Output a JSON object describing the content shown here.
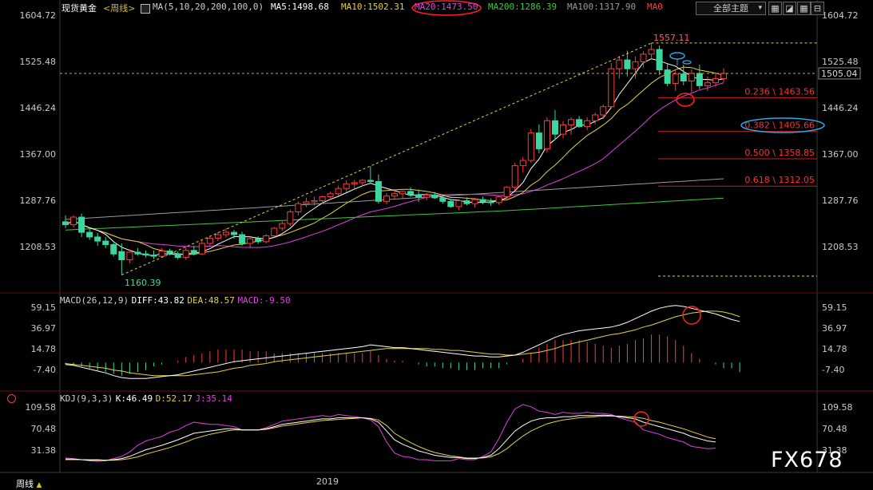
{
  "header": {
    "symbol": "现货黄金",
    "period": "周线",
    "ma_def": "MA(5,10,20,200,100,0)",
    "ma5": "MA5:1498.68",
    "ma10": "MA10:1502.31",
    "ma20": "MA20:1473.50",
    "ma200": "MA200:1286.39",
    "ma100": "MA100:1317.90",
    "ma0": "MA0",
    "theme_button": "全部主题",
    "macd": "MACD(26,12,9)",
    "diff": "DIFF:43.82",
    "dea": "DEA:48.57",
    "macd_val": "MACD:-9.50",
    "kdj": "KDJ(9,3,3)",
    "k": "K:46.49",
    "d": "D:52.17",
    "j": "J:35.14"
  },
  "footer": {
    "period_tab": "周线",
    "year": "2019"
  },
  "watermark": "FX678",
  "colors": {
    "up": "#ff3c3c",
    "down": "#3cd6a0",
    "ma5": "#ffffff",
    "ma10": "#e6d23c",
    "ma20": "#e040e0",
    "ma100": "#9a9a9a",
    "ma200": "#3cc83c",
    "dash": "#e6d23c",
    "circle_red": "#ff2020",
    "circle_blue": "#2aa8e8"
  },
  "chart_data": [
    {
      "type": "candlestick",
      "title": "现货黄金 周线",
      "ylim": [
        1160,
        1610
      ],
      "yticks": [
        "1604.72",
        "1525.48",
        "1446.24",
        "1367.00",
        "1287.76",
        "1208.53"
      ],
      "current_price": "1505.04",
      "high_label": "1557.11",
      "low_label": "1160.39",
      "fibonacci": [
        {
          "label": "0.236 \\ 1463.56",
          "value": 1463.56
        },
        {
          "label": "0.382 \\ 1405.66",
          "value": 1405.66
        },
        {
          "label": "0.500 \\ 1358.85",
          "value": 1358.85
        },
        {
          "label": "0.618 \\ 1312.05",
          "value": 1312.05
        }
      ],
      "candles": [
        [
          1251,
          1262,
          1240,
          1246
        ],
        [
          1246,
          1262,
          1241,
          1259
        ],
        [
          1259,
          1265,
          1225,
          1233
        ],
        [
          1233,
          1238,
          1220,
          1225
        ],
        [
          1225,
          1232,
          1210,
          1218
        ],
        [
          1218,
          1225,
          1206,
          1212
        ],
        [
          1212,
          1215,
          1192,
          1196
        ],
        [
          1200,
          1214,
          1160,
          1186
        ],
        [
          1186,
          1204,
          1180,
          1199
        ],
        [
          1199,
          1206,
          1193,
          1196
        ],
        [
          1196,
          1202,
          1190,
          1194
        ],
        [
          1194,
          1202,
          1187,
          1192
        ],
        [
          1192,
          1206,
          1190,
          1201
        ],
        [
          1201,
          1205,
          1193,
          1196
        ],
        [
          1196,
          1200,
          1187,
          1190
        ],
        [
          1190,
          1207,
          1186,
          1202
        ],
        [
          1202,
          1210,
          1193,
          1196
        ],
        [
          1196,
          1221,
          1194,
          1214
        ],
        [
          1214,
          1227,
          1210,
          1223
        ],
        [
          1223,
          1233,
          1218,
          1229
        ],
        [
          1229,
          1240,
          1224,
          1233
        ],
        [
          1233,
          1237,
          1222,
          1229
        ],
        [
          1229,
          1234,
          1210,
          1214
        ],
        [
          1214,
          1224,
          1206,
          1222
        ],
        [
          1222,
          1226,
          1213,
          1217
        ],
        [
          1217,
          1230,
          1214,
          1227
        ],
        [
          1227,
          1242,
          1224,
          1240
        ],
        [
          1240,
          1252,
          1235,
          1248
        ],
        [
          1248,
          1272,
          1244,
          1268
        ],
        [
          1268,
          1286,
          1262,
          1282
        ],
        [
          1282,
          1292,
          1276,
          1285
        ],
        [
          1285,
          1294,
          1279,
          1287
        ],
        [
          1287,
          1296,
          1282,
          1294
        ],
        [
          1294,
          1303,
          1289,
          1299
        ],
        [
          1299,
          1313,
          1295,
          1308
        ],
        [
          1308,
          1322,
          1302,
          1316
        ],
        [
          1316,
          1323,
          1308,
          1318
        ],
        [
          1318,
          1324,
          1312,
          1322
        ],
        [
          1322,
          1346,
          1318,
          1320
        ],
        [
          1320,
          1332,
          1282,
          1286
        ],
        [
          1286,
          1300,
          1281,
          1295
        ],
        [
          1295,
          1306,
          1289,
          1299
        ],
        [
          1299,
          1305,
          1291,
          1303
        ],
        [
          1303,
          1310,
          1294,
          1297
        ],
        [
          1297,
          1306,
          1285,
          1293
        ],
        [
          1293,
          1300,
          1288,
          1297
        ],
        [
          1297,
          1302,
          1290,
          1292
        ],
        [
          1292,
          1296,
          1282,
          1286
        ],
        [
          1286,
          1290,
          1275,
          1277
        ],
        [
          1277,
          1290,
          1271,
          1287
        ],
        [
          1287,
          1293,
          1279,
          1282
        ],
        [
          1282,
          1292,
          1276,
          1289
        ],
        [
          1289,
          1294,
          1281,
          1285
        ],
        [
          1285,
          1291,
          1278,
          1284
        ],
        [
          1284,
          1296,
          1280,
          1294
        ],
        [
          1294,
          1312,
          1290,
          1310
        ],
        [
          1310,
          1352,
          1305,
          1347
        ],
        [
          1347,
          1362,
          1335,
          1356
        ],
        [
          1356,
          1410,
          1352,
          1403
        ],
        [
          1403,
          1418,
          1368,
          1376
        ],
        [
          1376,
          1430,
          1370,
          1424
        ],
        [
          1424,
          1442,
          1391,
          1401
        ],
        [
          1401,
          1423,
          1394,
          1417
        ],
        [
          1417,
          1430,
          1400,
          1426
        ],
        [
          1426,
          1432,
          1412,
          1414
        ],
        [
          1414,
          1430,
          1408,
          1424
        ],
        [
          1424,
          1438,
          1418,
          1434
        ],
        [
          1434,
          1452,
          1427,
          1448
        ],
        [
          1448,
          1523,
          1445,
          1513
        ],
        [
          1513,
          1535,
          1496,
          1528
        ],
        [
          1528,
          1544,
          1500,
          1513
        ],
        [
          1513,
          1534,
          1496,
          1525
        ],
        [
          1525,
          1543,
          1515,
          1538
        ],
        [
          1538,
          1557,
          1530,
          1546
        ],
        [
          1546,
          1553,
          1502,
          1511
        ],
        [
          1511,
          1521,
          1483,
          1488
        ],
        [
          1488,
          1512,
          1475,
          1504
        ],
        [
          1504,
          1520,
          1485,
          1492
        ],
        [
          1492,
          1512,
          1473,
          1505
        ],
        [
          1505,
          1520,
          1478,
          1484
        ],
        [
          1484,
          1500,
          1475,
          1489
        ],
        [
          1489,
          1506,
          1482,
          1496
        ],
        [
          1496,
          1514,
          1490,
          1505
        ]
      ]
    },
    {
      "type": "macd",
      "title": "MACD(26,12,9)",
      "yticks": [
        "59.15",
        "36.97",
        "14.78",
        "-7.40"
      ],
      "ylim": [
        -15,
        67
      ],
      "series": [
        {
          "name": "DIFF",
          "values": [
            -2,
            -3,
            -5,
            -7,
            -9,
            -11,
            -14,
            -16,
            -17,
            -17,
            -17,
            -16,
            -15,
            -14,
            -13,
            -11,
            -9,
            -7,
            -5,
            -3,
            -1,
            1,
            2,
            3,
            4,
            5,
            6,
            7,
            8,
            9,
            10,
            11,
            12,
            13,
            14,
            15,
            16,
            17,
            19,
            18,
            17,
            16,
            16,
            15,
            14,
            13,
            12,
            11,
            10,
            9,
            8,
            7,
            7,
            6,
            6,
            7,
            8,
            11,
            15,
            19,
            23,
            27,
            30,
            32,
            34,
            35,
            36,
            37,
            38,
            40,
            43,
            47,
            51,
            55,
            58,
            60,
            61,
            60,
            58,
            56,
            54,
            52,
            49,
            46,
            44
          ]
        },
        {
          "name": "DEA",
          "values": [
            -1,
            -2,
            -3,
            -4,
            -5,
            -6,
            -8,
            -9,
            -11,
            -12,
            -13,
            -14,
            -14,
            -14,
            -14,
            -14,
            -13,
            -12,
            -11,
            -10,
            -8,
            -6,
            -5,
            -3,
            -2,
            -1,
            1,
            2,
            3,
            4,
            5,
            6,
            7,
            8,
            9,
            10,
            11,
            12,
            13,
            14,
            15,
            15,
            15,
            15,
            15,
            15,
            14,
            14,
            13,
            13,
            12,
            11,
            10,
            9,
            9,
            8,
            8,
            9,
            10,
            11,
            13,
            15,
            18,
            20,
            22,
            24,
            26,
            28,
            30,
            31,
            33,
            35,
            38,
            40,
            43,
            46,
            49,
            51,
            53,
            54,
            55,
            55,
            54,
            52,
            49
          ]
        },
        {
          "name": "MACD",
          "values": [
            -2,
            -2,
            -4,
            -6,
            -8,
            -10,
            -12,
            -14,
            -12,
            -10,
            -8,
            -4,
            -2,
            0,
            2,
            6,
            8,
            10,
            12,
            14,
            14,
            14,
            14,
            12,
            12,
            12,
            10,
            10,
            10,
            10,
            10,
            10,
            10,
            10,
            10,
            10,
            10,
            10,
            12,
            8,
            4,
            2,
            2,
            0,
            -2,
            -4,
            -4,
            -6,
            -6,
            -8,
            -8,
            -8,
            -6,
            -6,
            -6,
            -2,
            0,
            4,
            10,
            16,
            20,
            24,
            24,
            24,
            24,
            22,
            20,
            18,
            16,
            18,
            20,
            24,
            26,
            30,
            30,
            28,
            24,
            18,
            10,
            4,
            0,
            -2,
            -6,
            -6,
            -10
          ]
        }
      ]
    },
    {
      "type": "kdj",
      "title": "KDJ(9,3,3)",
      "yticks": [
        "109.58",
        "70.48",
        "31.38"
      ],
      "ylim": [
        5,
        118
      ],
      "series": [
        {
          "name": "K",
          "values": [
            15,
            15,
            14,
            13,
            13,
            13,
            14,
            16,
            20,
            26,
            32,
            36,
            40,
            45,
            50,
            56,
            62,
            64,
            66,
            68,
            70,
            70,
            68,
            68,
            68,
            70,
            74,
            78,
            80,
            82,
            84,
            86,
            88,
            88,
            90,
            90,
            90,
            90,
            88,
            82,
            66,
            50,
            42,
            36,
            30,
            26,
            22,
            20,
            18,
            18,
            16,
            16,
            18,
            22,
            34,
            50,
            66,
            76,
            84,
            88,
            90,
            90,
            92,
            92,
            94,
            94,
            94,
            95,
            94,
            92,
            90,
            88,
            82,
            78,
            74,
            70,
            66,
            62,
            56,
            52,
            48,
            46
          ]
        },
        {
          "name": "D",
          "values": [
            14,
            14,
            14,
            14,
            14,
            13,
            13,
            14,
            16,
            19,
            24,
            28,
            32,
            36,
            41,
            46,
            52,
            56,
            60,
            63,
            66,
            68,
            68,
            68,
            68,
            69,
            72,
            75,
            77,
            79,
            81,
            83,
            85,
            86,
            87,
            88,
            89,
            90,
            89,
            86,
            76,
            62,
            53,
            45,
            38,
            32,
            27,
            24,
            21,
            19,
            17,
            17,
            17,
            19,
            25,
            34,
            46,
            57,
            66,
            73,
            79,
            83,
            86,
            88,
            90,
            91,
            92,
            93,
            93,
            93,
            92,
            91,
            89,
            85,
            82,
            78,
            74,
            70,
            65,
            60,
            55,
            52
          ]
        },
        {
          "name": "J",
          "values": [
            17,
            16,
            14,
            12,
            11,
            12,
            16,
            20,
            28,
            40,
            48,
            52,
            56,
            64,
            68,
            76,
            82,
            80,
            78,
            78,
            76,
            74,
            68,
            68,
            68,
            72,
            78,
            84,
            86,
            88,
            90,
            92,
            94,
            92,
            96,
            94,
            92,
            90,
            86,
            74,
            46,
            26,
            20,
            18,
            14,
            14,
            12,
            12,
            12,
            16,
            14,
            14,
            20,
            28,
            52,
            82,
            106,
            114,
            110,
            102,
            100,
            96,
            100,
            98,
            98,
            100,
            98,
            98,
            96,
            90,
            86,
            82,
            68,
            64,
            60,
            54,
            50,
            46,
            38,
            36,
            34,
            35
          ]
        }
      ]
    }
  ]
}
